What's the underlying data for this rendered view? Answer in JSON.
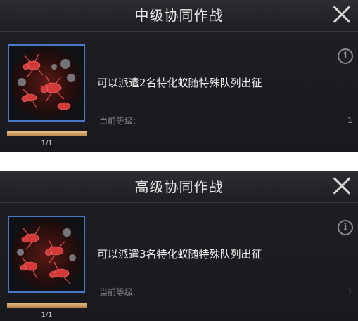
{
  "panels": [
    {
      "title": "中级协同作战",
      "description": "可以派遣2名特化蚁随特殊队列出征",
      "level_label": "当前等级:",
      "level_value": "1",
      "progress_text": "1/1",
      "progress": 1.0,
      "info_glyph": "i",
      "icons": {
        "close": "close-icon",
        "info": "info-icon",
        "portrait": "ant-squad-portrait"
      }
    },
    {
      "title": "高级协同作战",
      "description": "可以派遣3名特化蚁随特殊队列出征",
      "level_label": "当前等级:",
      "level_value": "1",
      "progress_text": "1/1",
      "progress": 1.0,
      "info_glyph": "i",
      "icons": {
        "close": "close-icon",
        "info": "info-icon",
        "portrait": "ant-squad-portrait"
      }
    }
  ],
  "colors": {
    "panel_bg": "#1b1c20",
    "portrait_border": "#4b78c8",
    "progress_fill": "#c99a5c",
    "title_text": "#e9e9e9"
  }
}
